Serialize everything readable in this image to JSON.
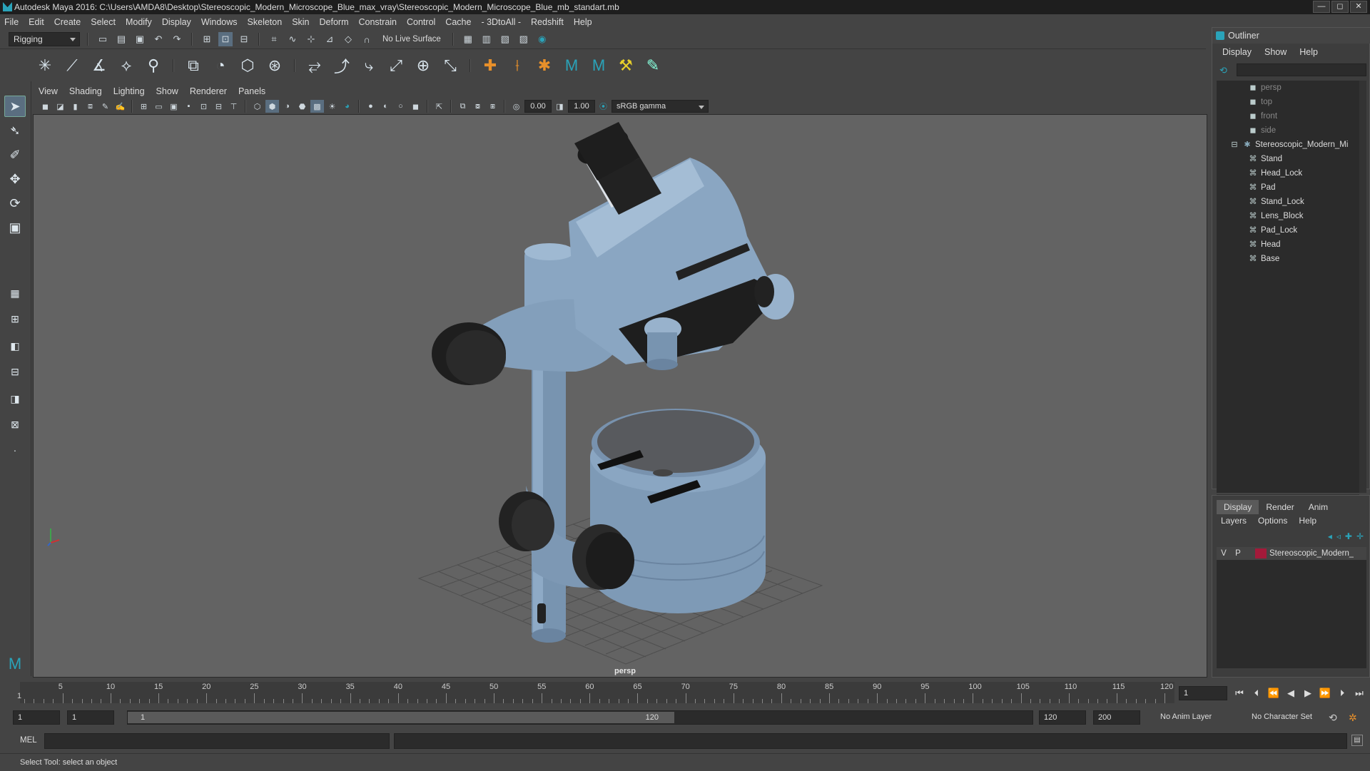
{
  "window": {
    "title": "Autodesk Maya 2016: C:\\Users\\AMDA8\\Desktop\\Stereoscopic_Modern_Microscope_Blue_max_vray\\Stereoscopic_Modern_Microscope_Blue_mb_standart.mb",
    "min": "—",
    "max": "◻",
    "close": "✕"
  },
  "menu": [
    "File",
    "Edit",
    "Create",
    "Select",
    "Modify",
    "Display",
    "Windows",
    "Skeleton",
    "Skin",
    "Deform",
    "Constrain",
    "Control",
    "Cache",
    "- 3DtoAll -",
    "Redshift",
    "Help"
  ],
  "status": {
    "mode": "Rigging",
    "live_surface": "No Live Surface"
  },
  "panel": {
    "menu": [
      "View",
      "Shading",
      "Lighting",
      "Show",
      "Renderer",
      "Panels"
    ],
    "near": "0.00",
    "gamma_val": "1.00",
    "colorspace": "sRGB gamma"
  },
  "viewport": {
    "camera_label": "persp"
  },
  "outliner": {
    "title": "Outliner",
    "menu": [
      "Display",
      "Show",
      "Help"
    ],
    "cameras": [
      "persp",
      "top",
      "front",
      "side"
    ],
    "group": "Stereoscopic_Modern_Mi",
    "children": [
      "Stand",
      "Head_Lock",
      "Pad",
      "Stand_Lock",
      "Lens_Block",
      "Pad_Lock",
      "Head",
      "Base"
    ]
  },
  "layers": {
    "tabs": [
      "Display",
      "Render",
      "Anim"
    ],
    "menu": [
      "Layers",
      "Options",
      "Help"
    ],
    "row": {
      "v": "V",
      "p": "P",
      "name": "Stereoscopic_Modern_",
      "color": "#a31a3a"
    }
  },
  "timeline": {
    "ticks": [
      "5",
      "10",
      "15",
      "20",
      "25",
      "30",
      "35",
      "40",
      "45",
      "50",
      "55",
      "60",
      "65",
      "70",
      "75",
      "80",
      "85",
      "90",
      "95",
      "100",
      "105",
      "110",
      "115",
      "120"
    ],
    "start_label": "1",
    "current": "1"
  },
  "range": {
    "start": "1",
    "playstart": "1",
    "inner_start": "1",
    "inner_end": "120",
    "end": "120",
    "anim_end": "200",
    "anim_layer": "No Anim Layer",
    "char_set": "No Character Set"
  },
  "cmd": {
    "label": "MEL"
  },
  "help": {
    "text": "Select Tool: select an object"
  }
}
